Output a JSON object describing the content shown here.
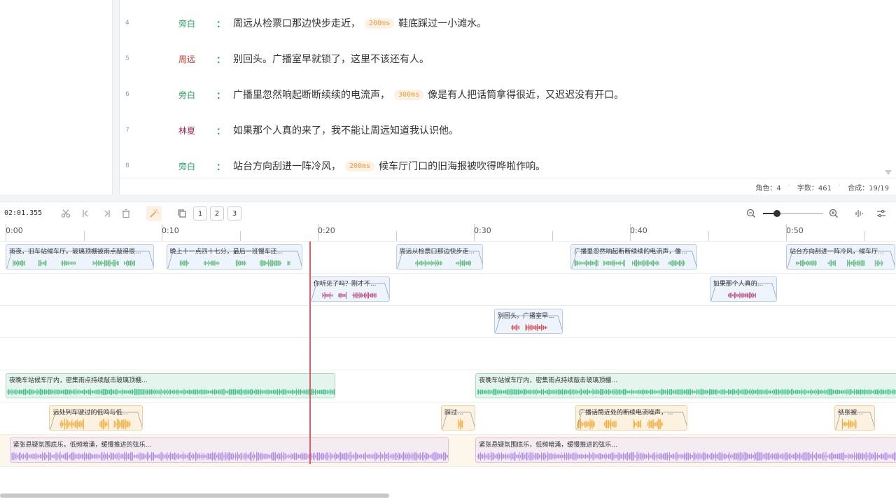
{
  "script": {
    "lines": [
      {
        "num": "4",
        "speaker": "旁白",
        "speaker_color": "#22a45d",
        "parts": [
          {
            "t": "text",
            "v": "周远从检票口那边快步走近，"
          },
          {
            "t": "pause",
            "v": "200ms"
          },
          {
            "t": "text",
            "v": "鞋底踩过一小滩水。"
          }
        ]
      },
      {
        "num": "5",
        "speaker": "周远",
        "speaker_color": "#c0392b",
        "parts": [
          {
            "t": "text",
            "v": "别回头。广播室早就锁了，这里不该还有人。"
          }
        ]
      },
      {
        "num": "6",
        "speaker": "旁白",
        "speaker_color": "#22a45d",
        "parts": [
          {
            "t": "text",
            "v": "广播里忽然响起断断续续的电流声，"
          },
          {
            "t": "pause",
            "v": "300ms"
          },
          {
            "t": "text",
            "v": "像是有人把话筒拿得很近，又迟迟没有开口。"
          }
        ]
      },
      {
        "num": "7",
        "speaker": "林夏",
        "speaker_color": "#a5275b",
        "parts": [
          {
            "t": "text",
            "v": "如果那个人真的来了，我不能让周远知道我认识他。"
          }
        ]
      },
      {
        "num": "8",
        "speaker": "旁白",
        "speaker_color": "#22a45d",
        "parts": [
          {
            "t": "text",
            "v": "站台方向刮进一阵冷风，"
          },
          {
            "t": "pause",
            "v": "200ms"
          },
          {
            "t": "text",
            "v": "候车厅门口的旧海报被吹得哗啦作响。"
          }
        ]
      }
    ],
    "colon": "："
  },
  "status": {
    "roles": "角色：4",
    "chars": "字数：461",
    "synth": "合成：19/19",
    "sep": "·"
  },
  "timeline": {
    "current_time": "02:01.355",
    "track_numbers": [
      "1",
      "2",
      "3"
    ],
    "ruler_labels": [
      "0:00",
      "0:10",
      "0:20",
      "0:30",
      "0:40",
      "0:50"
    ],
    "zoom_level": 0.23,
    "playhead_seconds": 19.5,
    "tracks": [
      {
        "kind": "voice",
        "color": "#5cb87a",
        "bg": "#eef4fb",
        "border": "#b9cde6",
        "clips": [
          {
            "label": "雨夜，旧车站候车厅。玻璃顶棚被雨点敲得很...",
            "start": 0.0,
            "end": 9.5
          },
          {
            "label": "晚上十一点四十七分，最后一班慢车还...",
            "start": 10.3,
            "end": 19.0
          },
          {
            "label": "周远从检票口那边快步走...",
            "start": 25.0,
            "end": 30.6
          },
          {
            "label": "广播里忽然响起断断续续的电流声，像...",
            "start": 36.2,
            "end": 44.3
          },
          {
            "label": "站台方向刮进一阵冷风，候车厅...",
            "start": 50.0,
            "end": 57.0
          }
        ]
      },
      {
        "kind": "voice",
        "color": "#b84d7a",
        "bg": "#eef4fb",
        "border": "#b9cde6",
        "clips": [
          {
            "label": "你听见了吗？刚才不...",
            "start": 19.5,
            "end": 24.6
          },
          {
            "label": "如果那个人真的...",
            "start": 45.1,
            "end": 49.4
          }
        ]
      },
      {
        "kind": "voice",
        "color": "#d14a4a",
        "bg": "#eef4fb",
        "border": "#b9cde6",
        "clips": [
          {
            "label": "别回头。广播室早...",
            "start": 31.3,
            "end": 35.7
          }
        ]
      },
      {
        "kind": "empty",
        "clips": []
      },
      {
        "kind": "ambient",
        "color": "#3fbf8a",
        "bg": "#e3f5ec",
        "border": "#a9dcc2",
        "clips": [
          {
            "label": "夜晚车站候车厅内，密集雨点持续敲击玻璃顶棚...",
            "start": 0.0,
            "end": 21.1
          },
          {
            "label": "夜晚车站候车厅内，密集雨点持续敲击玻璃顶棚...",
            "start": 30.1,
            "end": 57.4
          }
        ]
      },
      {
        "kind": "sfx",
        "color": "#f0a830",
        "bg": "#fdf1e0",
        "border": "#efcf9a",
        "clips": [
          {
            "label": "远处列车驶过的低鸣与低...",
            "start": 2.8,
            "end": 8.8
          },
          {
            "label": "踩过...",
            "start": 27.9,
            "end": 30.1
          },
          {
            "label": "广播话筒近处的断续电流噪声，...",
            "start": 36.5,
            "end": 43.7
          },
          {
            "label": "纸张被...",
            "start": 53.1,
            "end": 55.7
          }
        ]
      },
      {
        "kind": "music",
        "color": "#b08de3",
        "bg": "#f4ecf2",
        "border": "#d9c2d9",
        "clips": [
          {
            "label": "紧张悬疑氛围底乐，低频暗涌，缓慢推进的弦乐...",
            "start": 0.25,
            "end": 28.4
          },
          {
            "label": "紧张悬疑氛围底乐，低频暗涌，缓慢推进的弦乐...",
            "start": 30.1,
            "end": 57.4
          }
        ]
      }
    ]
  },
  "icons": {
    "cut": "scissors-icon",
    "prev": "skip-back-icon",
    "next": "skip-forward-icon",
    "delete": "trash-icon",
    "magic": "magic-wand-icon",
    "copy": "copy-icon",
    "zoom_out": "zoom-out-icon",
    "zoom_in": "zoom-in-icon",
    "wave": "waveform-icon",
    "settings": "sliders-icon"
  }
}
